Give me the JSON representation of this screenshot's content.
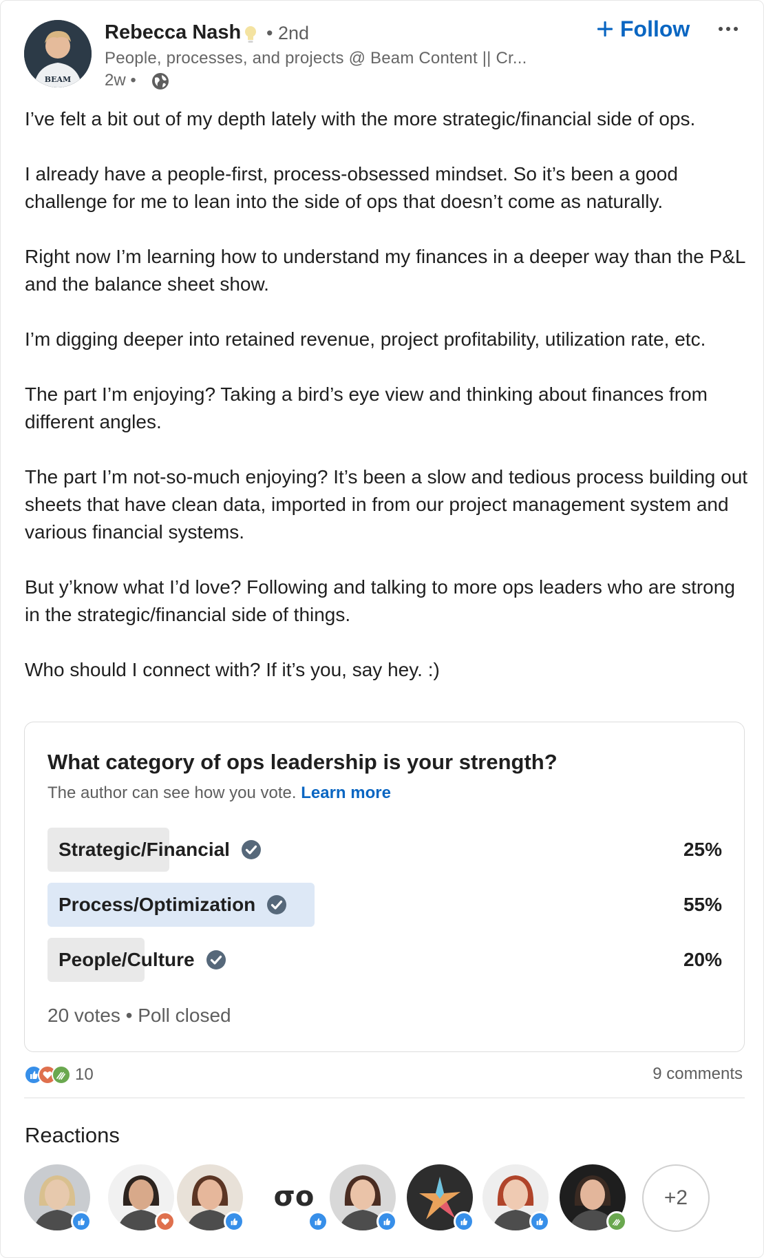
{
  "post": {
    "author": {
      "name": "Rebecca Nash",
      "degree": "• 2nd",
      "headline": "People, processes, and projects @ Beam Content || Cr...",
      "time": "2w •",
      "avatar_text": "BEAM"
    },
    "follow_label": "Follow",
    "paragraphs": [
      "I’ve felt a bit out of my depth lately with the more strategic/financial side of ops.",
      "I already have a people-first, process-obsessed mindset. So it’s been a good challenge for me to lean into the side of ops that doesn’t come as naturally.",
      "Right now I’m learning how to understand my finances in a deeper way than the P&L and the balance sheet show.",
      "I’m digging deeper into retained revenue, project profitability, utilization rate, etc.",
      "The part I’m enjoying? Taking a bird’s eye view and thinking about finances from different angles.",
      "The part I’m not-so-much enjoying? It’s been a slow and tedious process building out sheets that have clean data, imported in from our project management system and various financial systems.",
      "But y’know what I’d love? Following and talking to more ops leaders who are strong in the strategic/financial side of things.",
      "Who should I connect with? If it’s you, say hey. :)"
    ]
  },
  "poll": {
    "question": "What category of ops leadership is your strength?",
    "note": "The author can see how you vote.",
    "learn_more": "Learn more",
    "options": [
      {
        "label": "Strategic/Financial",
        "percent_label": "25%",
        "share": 0.25,
        "leading": false
      },
      {
        "label": "Process/Optimization",
        "percent_label": "55%",
        "share": 0.55,
        "leading": true
      },
      {
        "label": "People/Culture",
        "percent_label": "20%",
        "share": 0.2,
        "leading": false
      }
    ],
    "footer": "20 votes • Poll closed"
  },
  "social": {
    "reaction_count": "10",
    "comments": "9 comments",
    "reactions_title": "Reactions",
    "more_count": "+2",
    "reactors": [
      {
        "kind": "photo",
        "reaction": "like",
        "skin": "#e7c9ad",
        "hair": "#d9c08f",
        "bg": "#c9ccd0"
      },
      {
        "kind": "photo",
        "reaction": "love",
        "skin": "#d8a98a",
        "hair": "#2d241f",
        "bg": "#f1f1f1"
      },
      {
        "kind": "photo",
        "reaction": "like",
        "skin": "#e6b79b",
        "hair": "#5b3524",
        "bg": "#e8e1d8"
      },
      {
        "kind": "logo",
        "reaction": "like",
        "logo_text": "σo"
      },
      {
        "kind": "photo",
        "reaction": "like",
        "skin": "#eac3a8",
        "hair": "#4a2d22",
        "bg": "#d8d8d8"
      },
      {
        "kind": "star",
        "reaction": "like"
      },
      {
        "kind": "photo",
        "reaction": "like",
        "skin": "#efcab2",
        "hair": "#b0442a",
        "bg": "#eeeeee"
      },
      {
        "kind": "photo",
        "reaction": "support",
        "skin": "#e3b69b",
        "hair": "#3a2a22",
        "bg": "#1e1e1e"
      }
    ]
  },
  "colors": {
    "accent": "#0a66c2",
    "like": "#378fe9",
    "love": "#df704d",
    "support": "#6aa84f"
  }
}
